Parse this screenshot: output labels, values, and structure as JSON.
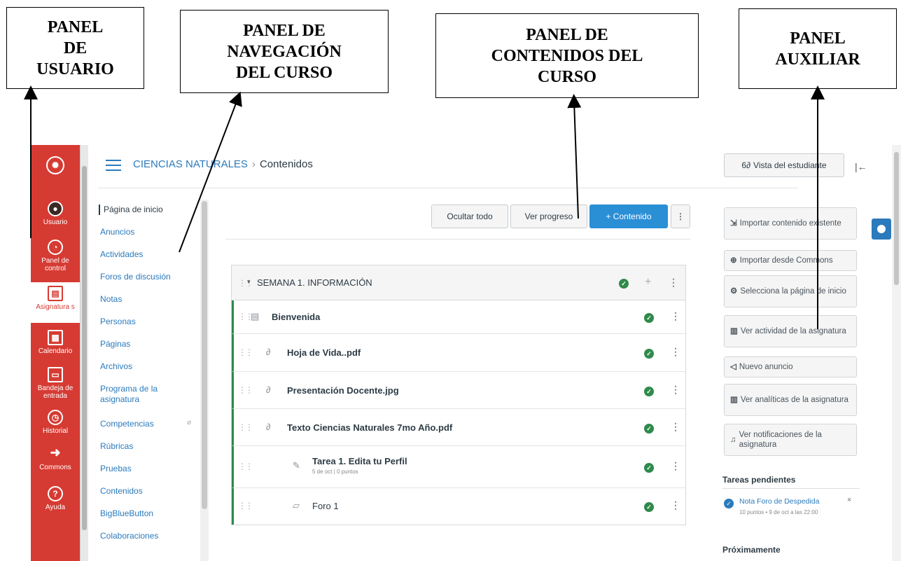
{
  "annotations": {
    "user_panel": [
      "PANEL",
      "DE",
      "USUARIO"
    ],
    "nav_panel": [
      "PANEL DE",
      "NAVEGACIÓN",
      "DEL CURSO"
    ],
    "content_panel": [
      "PANEL DE",
      "CONTENIDOS DEL",
      "CURSO"
    ],
    "aux_panel": [
      "PANEL",
      "AUXILIAR"
    ]
  },
  "global_nav": [
    {
      "label": "",
      "icon": "canvas-logo-icon"
    },
    {
      "label": "Usuario",
      "icon": "user-avatar-icon"
    },
    {
      "label": "Panel de control",
      "icon": "dashboard-icon"
    },
    {
      "label": "Asignatura s",
      "icon": "courses-icon"
    },
    {
      "label": "Calendario",
      "icon": "calendar-icon"
    },
    {
      "label": "Bandeja de entrada",
      "icon": "inbox-icon"
    },
    {
      "label": "Historial",
      "icon": "history-icon"
    },
    {
      "label": "Commons",
      "icon": "commons-icon"
    },
    {
      "label": "Ayuda",
      "icon": "help-icon"
    }
  ],
  "header": {
    "course": "CIENCIAS NATURALES",
    "separator": "›",
    "page": "Contenidos",
    "student_view": "Vista del estudiante"
  },
  "course_nav": [
    "Página de inicio",
    "Anuncios",
    "Actividades",
    "Foros de discusión",
    "Notas",
    "Personas",
    "Páginas",
    "Archivos",
    "Programa de la asignatura",
    "Competencias",
    "Rúbricas",
    "Pruebas",
    "Contenidos",
    "BigBlueButton",
    "Colaboraciones"
  ],
  "toolbar": {
    "hide_all": "Ocultar todo",
    "view_progress": "Ver progreso",
    "add_content": "+ Contenido"
  },
  "module": {
    "title": "SEMANA 1. INFORMACIÓN",
    "items": [
      {
        "title": "Bienvenida",
        "sub": "",
        "icon": "page-icon"
      },
      {
        "title": "Hoja de Vida..pdf",
        "sub": "",
        "icon": "attachment-icon"
      },
      {
        "title": "Presentación Docente.jpg",
        "sub": "",
        "icon": "attachment-icon"
      },
      {
        "title": "Texto Ciencias Naturales 7mo Año.pdf",
        "sub": "",
        "icon": "attachment-icon"
      },
      {
        "title": "Tarea 1. Edita tu Perfil",
        "sub": "5 de oct | 0 puntos",
        "icon": "assignment-icon"
      },
      {
        "title": "Foro 1",
        "sub": "",
        "icon": "discussion-icon"
      }
    ]
  },
  "sidebar": {
    "buttons": [
      "Importar contenido existente",
      "Importar desde Commons",
      "Selecciona la página de inicio",
      "Ver actividad de la asignatura",
      "Nuevo anuncio",
      "Ver analíticas de la asignatura",
      "Ver notificaciones de la asignatura"
    ],
    "todo_heading": "Tareas pendientes",
    "todo_item": "Nota Foro de Despedida",
    "todo_meta": "10 puntos • 9 de oct a las 22:00",
    "upcoming_heading": "Próximamente"
  }
}
